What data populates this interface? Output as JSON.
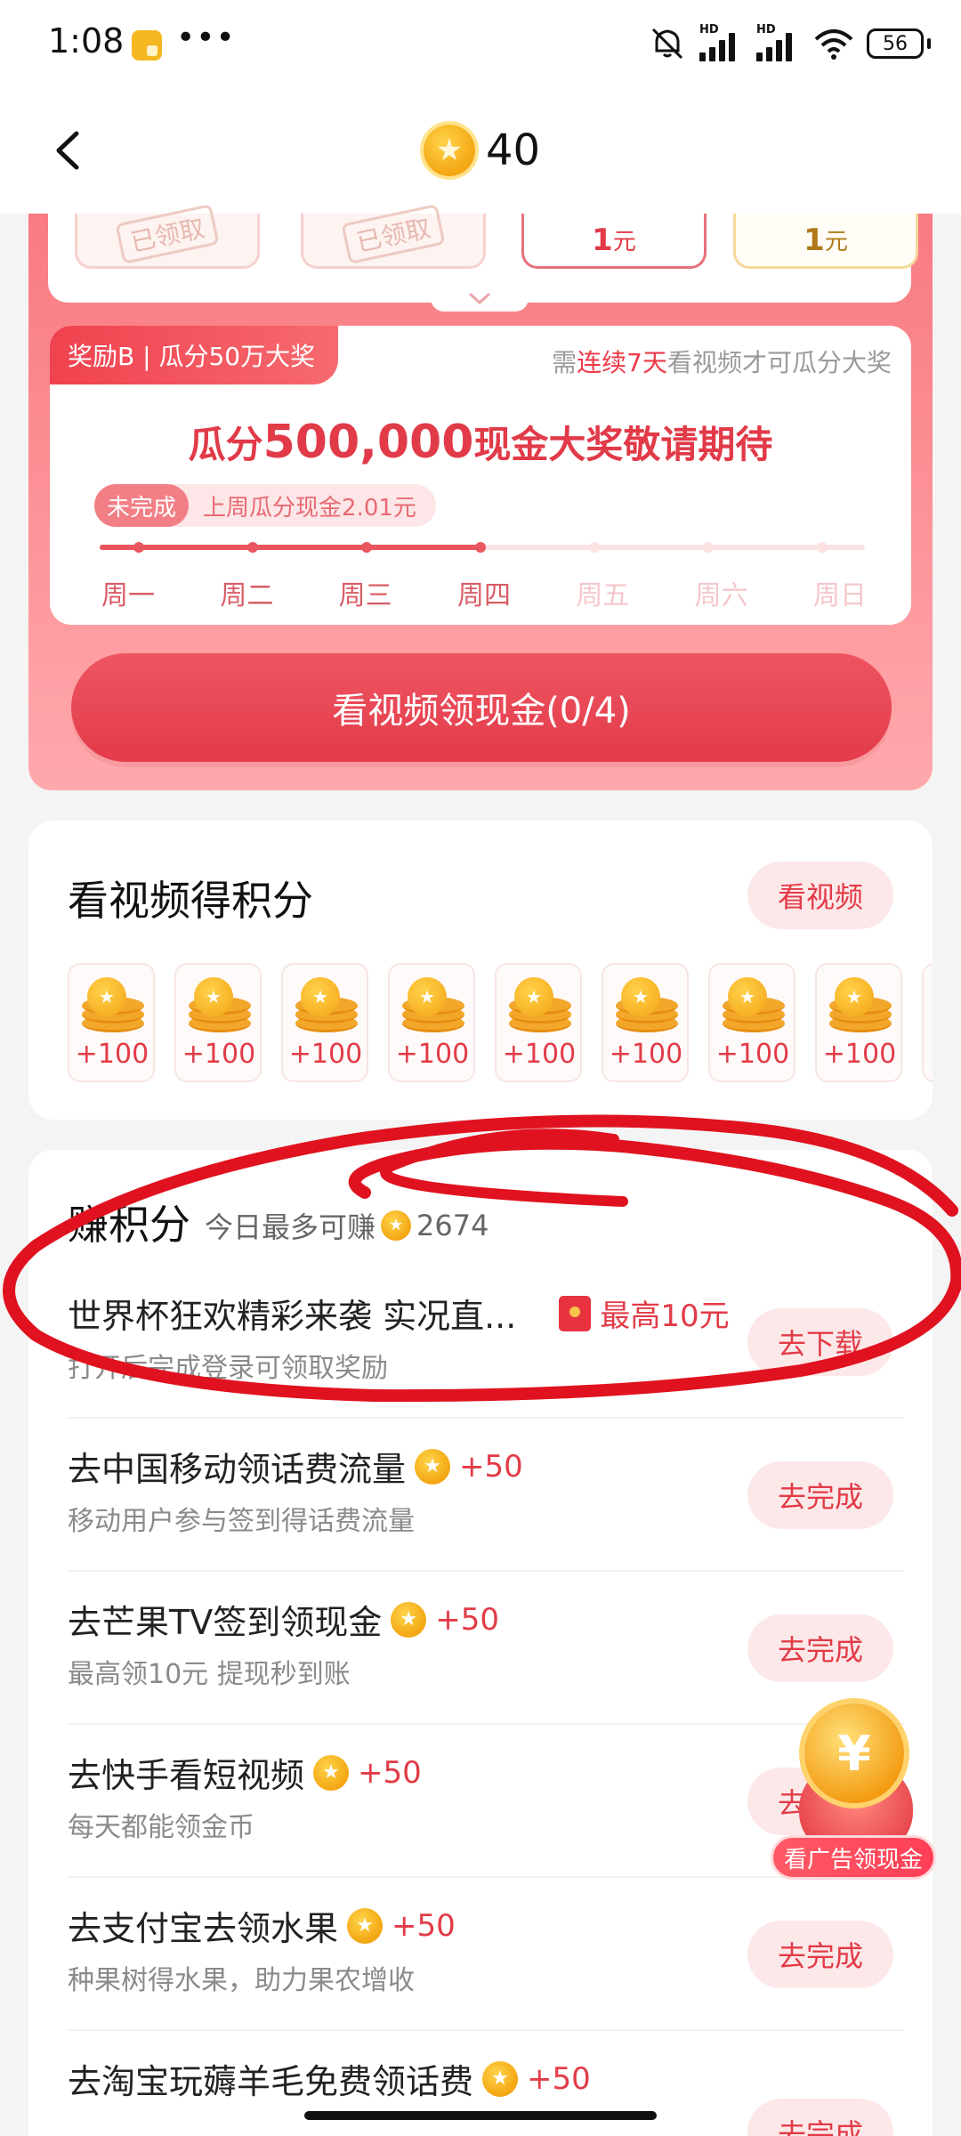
{
  "status_bar": {
    "time": "1:08",
    "dots": "•••",
    "hd1": "HD",
    "hd2": "HD",
    "battery": "56"
  },
  "nav": {
    "points": "40"
  },
  "prize_strip": {
    "cards": [
      {
        "label": "已领取"
      },
      {
        "label": "已领取"
      },
      {
        "amount": "1",
        "unit": "元"
      },
      {
        "amount": "1",
        "unit": "元"
      }
    ]
  },
  "reward_b": {
    "tag": "奖励B | 瓜分50万大奖",
    "note_prefix": "需",
    "note_highlight": "连续7天",
    "note_suffix": "看视频才可瓜分大奖",
    "title_prefix": "瓜分",
    "title_amount": "500,000",
    "title_suffix": "现金大奖敬请期待",
    "status_badge": "未完成",
    "last_week": "上周瓜分现金2.01元",
    "progress": 0.5,
    "days": [
      "周一",
      "周二",
      "周三",
      "周四",
      "周五",
      "周六",
      "周日"
    ],
    "completed_days": 4
  },
  "watch_cash_button": "看视频领现金(0/4)",
  "video_points": {
    "title": "看视频得积分",
    "button": "看视频",
    "tiles": [
      "+100",
      "+100",
      "+100",
      "+100",
      "+100",
      "+100",
      "+100",
      "+100"
    ]
  },
  "earn": {
    "title": "赚积分",
    "subtitle": "今日最多可赚",
    "max_points": "2674",
    "tasks": [
      {
        "name": "世界杯狂欢精彩来袭 实况直...",
        "reward": "最高10元",
        "desc": "打开后完成登录可领取奖励",
        "button": "去下载"
      },
      {
        "name": "去中国移动领话费流量",
        "points": "+50",
        "desc": "移动用户参与签到得话费流量",
        "button": "去完成"
      },
      {
        "name": "去芒果TV签到领现金",
        "points": "+50",
        "desc": "最高领10元 提现秒到账",
        "button": "去完成"
      },
      {
        "name": "去快手看短视频",
        "points": "+50",
        "desc": "每天都能领金币",
        "button": "去完成"
      },
      {
        "name": "去支付宝去领水果",
        "points": "+50",
        "desc": "种果树得水果，助力果农增收",
        "button": "去完成"
      },
      {
        "name": "去淘宝玩薅羊毛免费领话费",
        "points": "+50",
        "desc": "",
        "button": "去完成"
      }
    ]
  },
  "float_ad": {
    "label": "看广告领现金",
    "symbol": "¥"
  },
  "colors": {
    "accent": "#e23b47",
    "panel": "#f97a82",
    "coin": "#f3a612"
  }
}
